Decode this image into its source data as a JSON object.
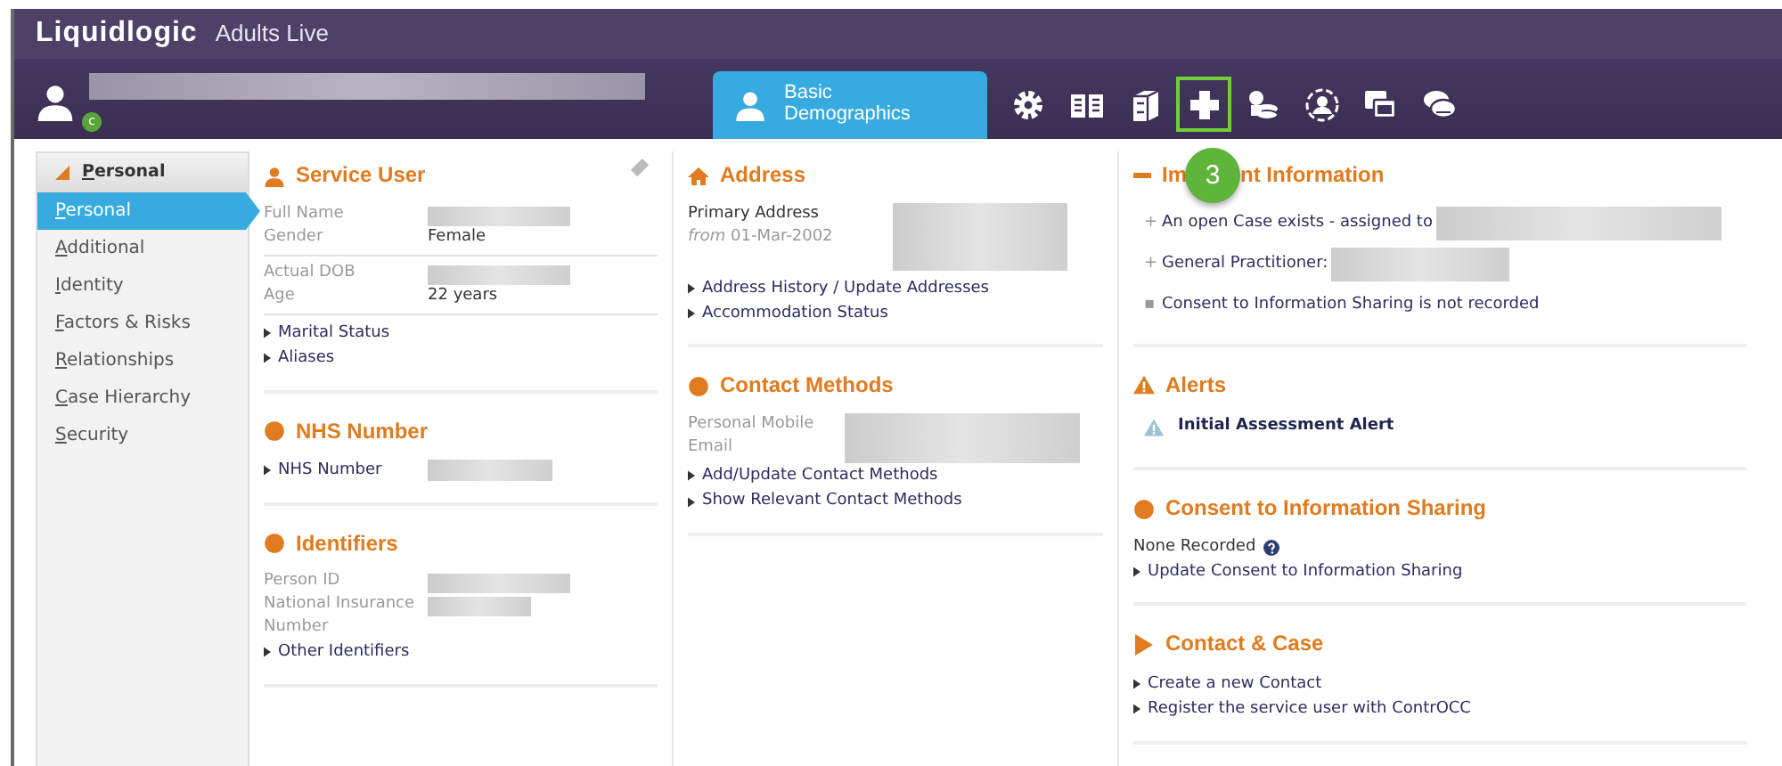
{
  "header": {
    "brand": "Liquidlogic",
    "environment": "Adults Live"
  },
  "patient_bar": {
    "name_redacted": true,
    "status_badge": "c",
    "tab": {
      "label": "Basic Demographics",
      "selected": true
    },
    "toolbar": [
      {
        "kind": "gear",
        "highlighted": false
      },
      {
        "kind": "book",
        "highlighted": false
      },
      {
        "kind": "cabinet",
        "highlighted": false
      },
      {
        "kind": "plus",
        "highlighted": true
      },
      {
        "kind": "coins",
        "highlighted": false
      },
      {
        "kind": "person",
        "highlighted": false
      },
      {
        "kind": "windows",
        "highlighted": false
      },
      {
        "kind": "chat",
        "highlighted": false
      }
    ]
  },
  "callout": {
    "label": "3"
  },
  "sidebar": {
    "header": "Personal",
    "expanded": true,
    "items": [
      {
        "label": "Personal",
        "selected": true
      },
      {
        "label": "Additional",
        "selected": false
      },
      {
        "label": "Identity",
        "selected": false
      },
      {
        "label": "Factors & Risks",
        "selected": false
      },
      {
        "label": "Relationships",
        "selected": false
      },
      {
        "label": "Case Hierarchy",
        "selected": false
      },
      {
        "label": "Security",
        "selected": false
      }
    ]
  },
  "columns": [
    [
      {
        "kind": "person",
        "title": "Service User",
        "edit_icon": true,
        "items": [
          {
            "kind": "field",
            "label": "Full Name",
            "redacted": true
          },
          {
            "kind": "field",
            "label": "Gender",
            "value": "Female"
          },
          {
            "kind": "rule"
          },
          {
            "kind": "field",
            "label": "Actual DOB",
            "redacted": true
          },
          {
            "kind": "field",
            "label": "Age",
            "value": "22 years"
          },
          {
            "kind": "rule"
          },
          {
            "kind": "link",
            "text": "Marital Status"
          },
          {
            "kind": "link",
            "text": "Aliases"
          }
        ]
      },
      {
        "kind": "dot",
        "title": "NHS Number",
        "items": [
          {
            "kind": "link",
            "text": "NHS Number",
            "redacted": true
          }
        ]
      },
      {
        "kind": "dot",
        "title": "Identifiers",
        "items": [
          {
            "kind": "field",
            "label": "Person ID",
            "redacted": true
          },
          {
            "kind": "field",
            "label": "National Insurance Number",
            "redacted": true
          },
          {
            "kind": "link",
            "text": "Other Identifiers"
          }
        ]
      }
    ],
    [
      {
        "kind": "house",
        "title": "Address",
        "items": [
          {
            "kind": "address",
            "label": "Primary Address",
            "sublabel": "*from* 01-Mar-2002",
            "redacted": true
          },
          {
            "kind": "link",
            "text": "Address History / Update Addresses"
          },
          {
            "kind": "link",
            "text": "Accommodation Status"
          }
        ]
      },
      {
        "kind": "dot",
        "title": "Contact Methods",
        "items": [
          {
            "kind": "group",
            "labels": [
              "Personal Mobile",
              "Email"
            ],
            "redacted": true
          },
          {
            "kind": "link",
            "text": "Add/Update Contact Methods"
          },
          {
            "kind": "link",
            "text": "Show Relevant Contact Methods"
          }
        ]
      }
    ],
    [
      {
        "kind": "minus",
        "title_parts": [
          "Im",
          "nt Information"
        ],
        "items": [
          {
            "kind": "bullet",
            "marker": "+",
            "text": "An open Case exists - assigned to",
            "redacted": true
          },
          {
            "kind": "bullet",
            "marker": "+",
            "text": "General Practitioner:",
            "redacted": true
          },
          {
            "kind": "bullet",
            "marker": "▪",
            "text": "Consent to Information Sharing is not recorded"
          }
        ]
      },
      {
        "kind": "warning",
        "title": "Alerts",
        "items": [
          {
            "kind": "alert",
            "text": "Initial Assessment Alert"
          }
        ]
      },
      {
        "kind": "dot",
        "title": "Consent to Information Sharing",
        "items": [
          {
            "kind": "note",
            "text": "None Recorded"
          },
          {
            "kind": "link",
            "text": "Update Consent to Information Sharing"
          }
        ]
      },
      {
        "kind": "play",
        "title": "Contact & Case",
        "items": [
          {
            "kind": "link",
            "text": "Create a new Contact"
          },
          {
            "kind": "link",
            "text": "Register the service user with ContrOCC"
          }
        ]
      }
    ]
  ]
}
